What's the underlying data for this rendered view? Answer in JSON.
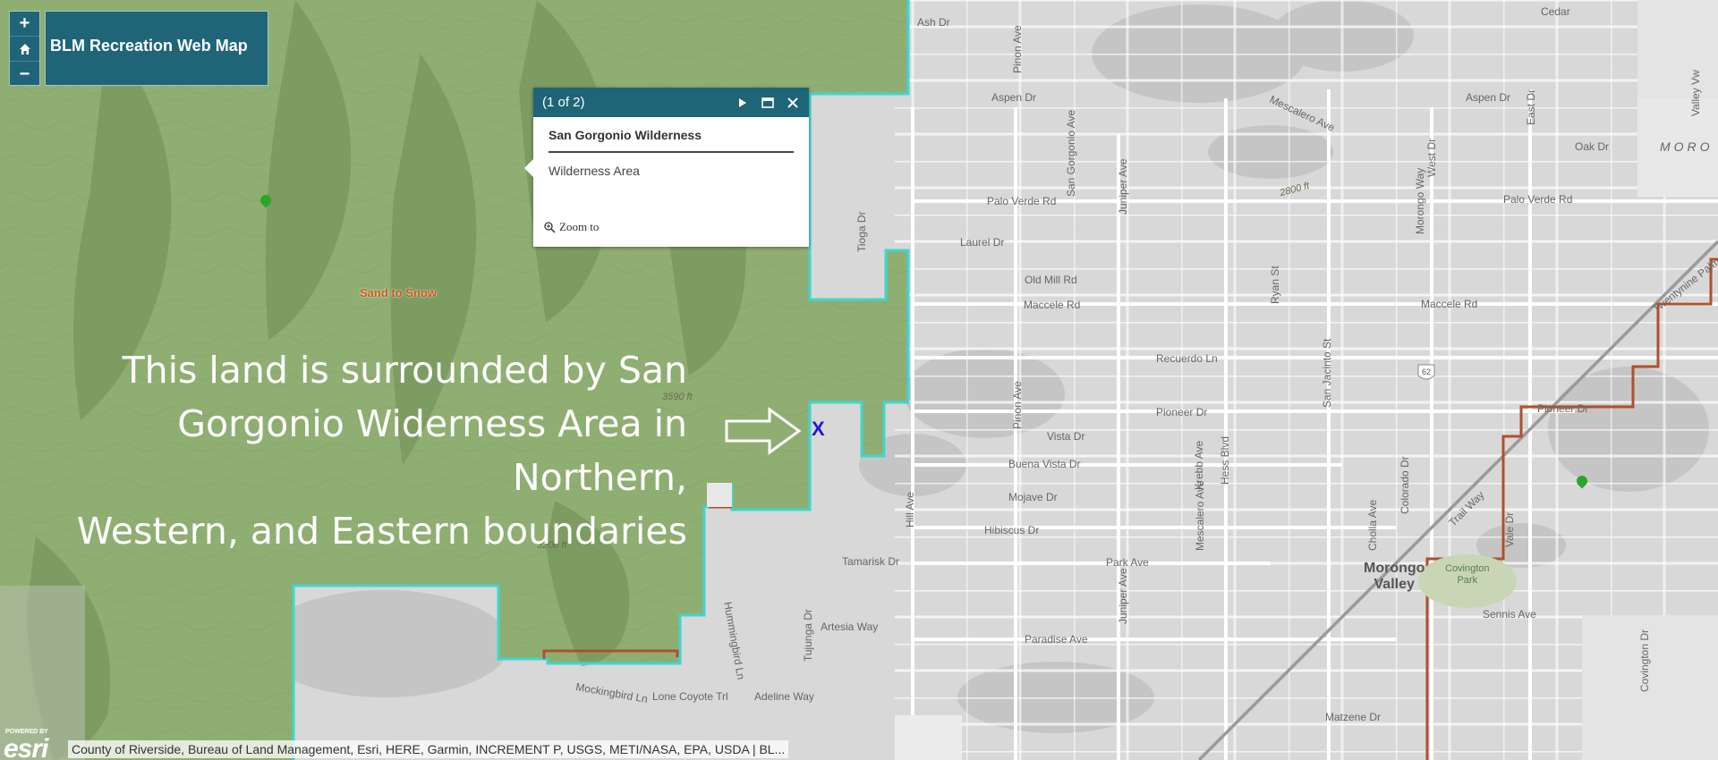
{
  "header": {
    "title": "BLM Recreation Web Map"
  },
  "zoom": {
    "zoom_in": "+",
    "home_icon": "home-icon",
    "zoom_out": "−"
  },
  "popup": {
    "count": "(1 of 2)",
    "title": "San Gorgonio Wilderness",
    "description": "Wilderness Area",
    "zoom_label": "Zoom to",
    "icons": [
      "next-arrow-icon",
      "maximize-icon",
      "close-icon"
    ]
  },
  "annotation": {
    "line1": "This land is surrounded by San",
    "line2": "Gorgonio Widerness Area in Northern,",
    "line3": "Western, and Eastern boundaries",
    "mark": "X"
  },
  "map_labels": {
    "streets": [
      "Ash Dr",
      "Aspen Dr",
      "Aspen Dr",
      "Palo Verde Rd",
      "Palo Verde Rd",
      "Laurel Dr",
      "Old Mill Rd",
      "Maccele Rd",
      "Maccele Rd",
      "Recuerdo Ln",
      "Pioneer Dr",
      "Pioneer Dr",
      "Vista Dr",
      "Buena Vista Dr",
      "Mojave Dr",
      "Hibiscus Dr",
      "Tamarisk Dr",
      "Park Ave",
      "Artesia Way",
      "Paradise Ave",
      "Mockingbird Ln",
      "Lone Coyote Trl",
      "Adeline Way",
      "Matzene Dr",
      "Sennis Ave",
      "Oak Dr",
      "Cedar",
      "Pinon Ave",
      "San Gorgonio Ave",
      "Juniper Ave",
      "Morongo Way",
      "West Dr",
      "East Dr",
      "Ryan St",
      "San Jacinto St",
      "Hill Ave",
      "Tioga Dr",
      "Krebb Ave",
      "Hess Blvd",
      "Mescalero Ave",
      "Cholla Ave",
      "Colorado Dr",
      "Trail Way",
      "Vale Dr",
      "Hummingbird Ln",
      "Tujunga Dr",
      "Covington Dr",
      "Valley Vw",
      "Twentynine Palms",
      "Mescalero Ave",
      "Pinon Ave",
      "Juniper Ave"
    ],
    "places": [
      "Morongo\nValley",
      "Covington\nPark",
      "MORO"
    ],
    "elevations": [
      "3590 ft",
      "3200 ft",
      "2800 ft"
    ],
    "route": "62",
    "trail": "Sand to Snow"
  },
  "attribution": {
    "powered_by": "POWERED BY",
    "logo": "esri",
    "text": "County of Riverside, Bureau of Land Management, Esri, HERE, Garmin, INCREMENT P, USGS, METI/NASA, EPA, USDA | BL..."
  },
  "colors": {
    "wilderness_fill": "#8fae72",
    "wilderness_border": "#3fd6d0",
    "blm_border": "#b0502a",
    "panel": "#1f6577",
    "pin": "#2aa62a"
  }
}
